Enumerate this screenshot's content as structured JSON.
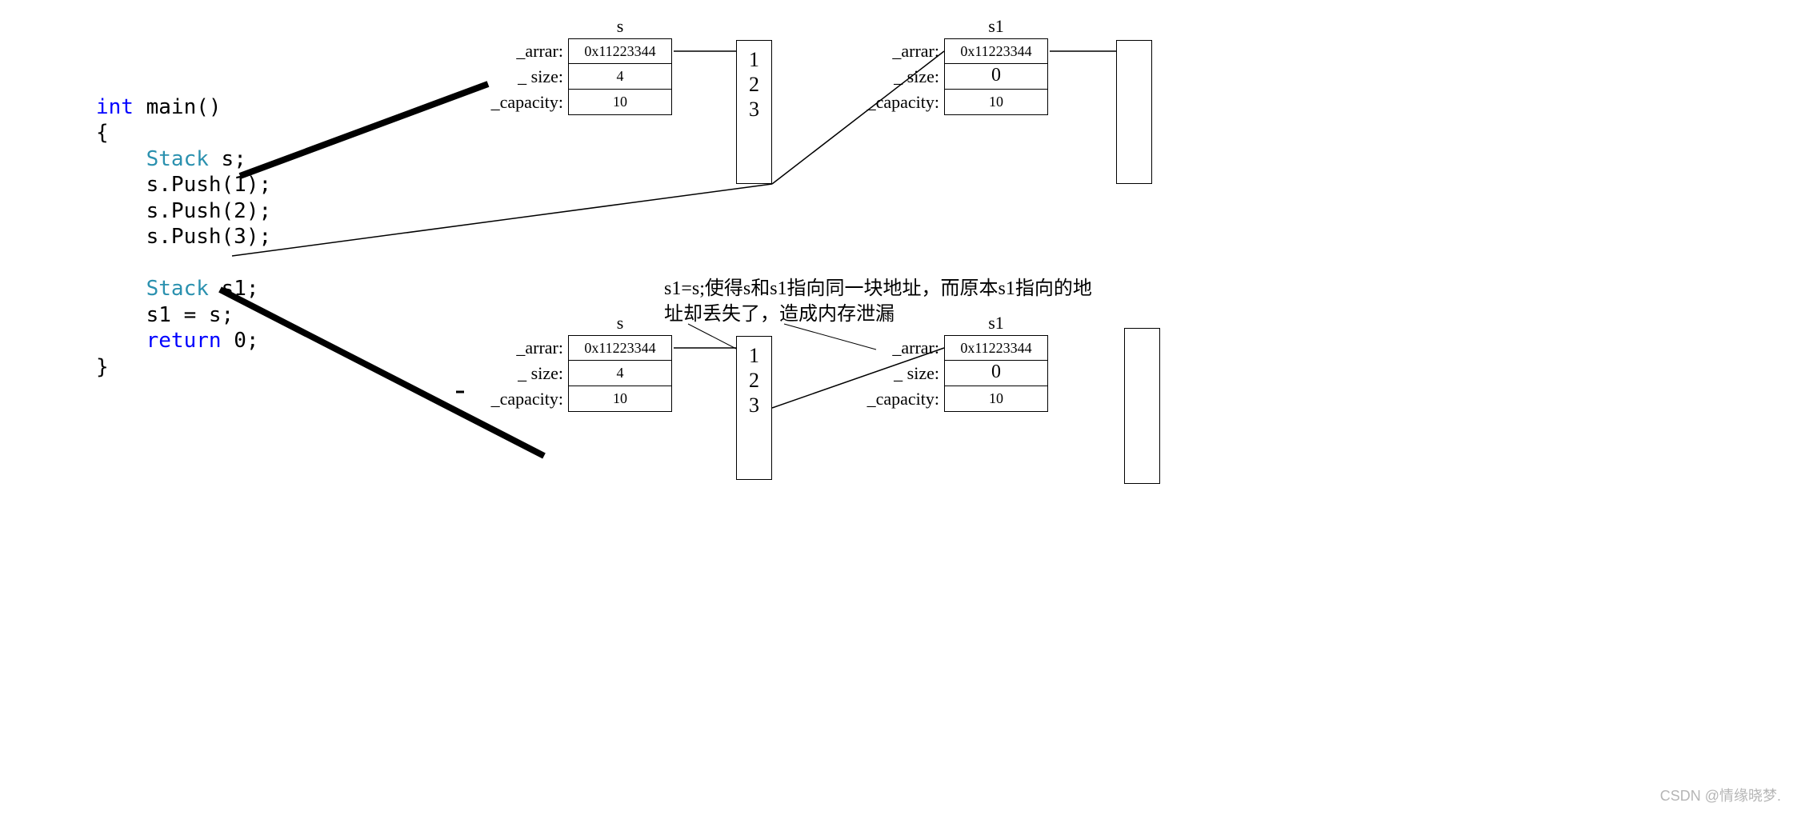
{
  "code": {
    "l1a": "int",
    "l1b": " main()",
    "l2": "{",
    "l3a": "    Stack",
    "l3b": " s;",
    "l4": "    s.Push(1);",
    "l5": "    s.Push(2);",
    "l6": "    s.Push(3);",
    "l7": "",
    "l8a": "    Stack",
    "l8b": " s1;",
    "l9": "    s1 = s;",
    "l10a": "    return",
    "l10b": " 0;",
    "l11": "}"
  },
  "labels": {
    "arrar": "_arrar:",
    "size": "_ size:",
    "capacity": "_capacity:"
  },
  "struct_s1_top": {
    "title": "s",
    "arrar": "0x11223344",
    "size": "4",
    "capacity": "10"
  },
  "struct_s1r_top": {
    "title": "s1",
    "arrar": "0x11223344",
    "size": "0",
    "capacity": "10"
  },
  "struct_s_bot": {
    "title": "s",
    "arrar": "0x11223344",
    "size": "4",
    "capacity": "10"
  },
  "struct_s1_bot": {
    "title": "s1",
    "arrar": "0x11223344",
    "size": "0",
    "capacity": "10"
  },
  "mem": {
    "top_left": "1\n2\n3",
    "top_right": "",
    "bot_left": "1\n2\n3",
    "bot_right": ""
  },
  "annotation": {
    "line1": "s1=s;使得s和s1指向同一块地址，而原本s1指向的地",
    "line2": "址却丢失了，造成内存泄漏"
  },
  "watermark": "CSDN @情缘晓梦."
}
